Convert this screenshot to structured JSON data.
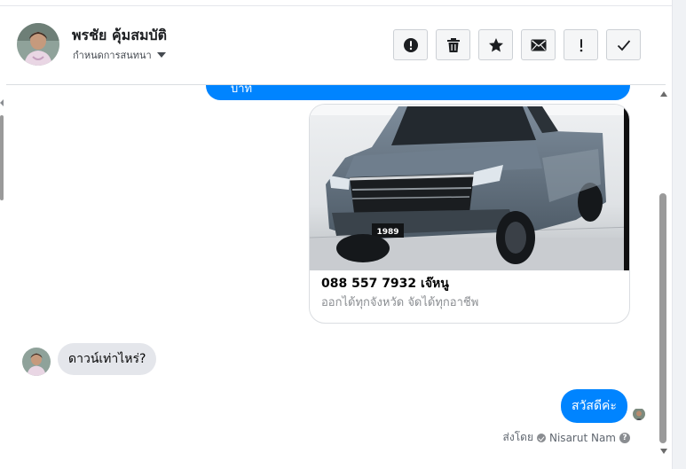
{
  "header": {
    "contact_name": "พรชัย คุ้มสมบัติ",
    "label_select": "กำหนดการสนทนา",
    "actions": [
      {
        "icon": "alert-icon",
        "label": "Mark as spam"
      },
      {
        "icon": "trash-icon",
        "label": "Delete"
      },
      {
        "icon": "star-icon",
        "label": "Star"
      },
      {
        "icon": "envelope-icon",
        "label": "Mark as unread"
      },
      {
        "icon": "exclamation-icon",
        "label": "Follow up"
      },
      {
        "icon": "check-icon",
        "label": "Mark as done"
      }
    ]
  },
  "thread": {
    "top_bubble_text": "บ่าท",
    "card": {
      "title": "088 557 7932 เจ๊หนู",
      "subtitle": "ออกได้ทุกจังหวัด จัดได้ทุกอาชีพ",
      "plate_text": "1989"
    },
    "incoming_message": "ดาวน์เท่าไหร่?",
    "outgoing_message": "สวัสดีค่ะ",
    "sent_by_prefix": "ส่งโดย",
    "sent_by_name": "Nisarut Nam",
    "help_glyph": "?"
  },
  "colors": {
    "messenger_blue": "#0084ff",
    "incoming_gray": "#e4e6eb",
    "border": "#dadde1"
  }
}
